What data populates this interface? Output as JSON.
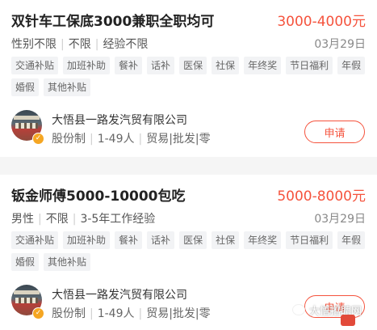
{
  "jobs": [
    {
      "title": "双针车工保底3000兼职全职均可",
      "salary": "3000-4000元",
      "requirements": [
        "性别不限",
        "不限",
        "经验不限"
      ],
      "date": "03月29日",
      "tags": [
        "交通补贴",
        "加班补助",
        "餐补",
        "话补",
        "医保",
        "社保",
        "年终奖",
        "节日福利",
        "年假",
        "婚假",
        "其他补贴"
      ],
      "company": {
        "name": "大悟县一路发汽贸有限公司",
        "meta": [
          "股份制",
          "1-49人",
          "贸易|批发|零售"
        ]
      },
      "apply_label": "申请"
    },
    {
      "title": "钣金师傅5000-10000包吃",
      "salary": "5000-8000元",
      "requirements": [
        "男性",
        "不限",
        "3-5年工作经验"
      ],
      "date": "03月29日",
      "tags": [
        "交通补贴",
        "加班补助",
        "餐补",
        "话补",
        "医保",
        "社保",
        "年终奖",
        "节日福利",
        "年假",
        "婚假",
        "其他补贴"
      ],
      "company": {
        "name": "大悟县一路发汽贸有限公司",
        "meta": [
          "股份制",
          "1-49人",
          "贸易|批发|零售"
        ]
      },
      "apply_label": "申请"
    }
  ],
  "watermark": "大悟招聘网",
  "colors": {
    "accent": "#f5533d",
    "tag_bg": "#f2f3f5",
    "verified": "#f5a623"
  }
}
